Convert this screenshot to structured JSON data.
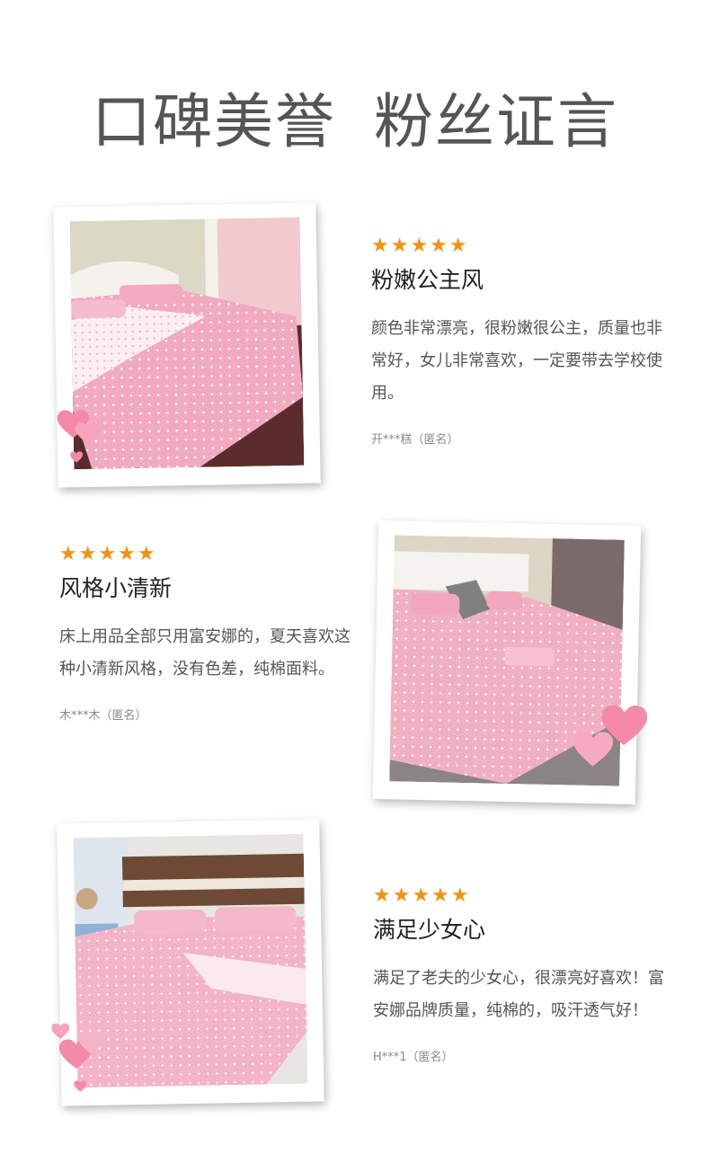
{
  "page": {
    "title_left": "口碑美誉",
    "title_right": "粉丝证言"
  },
  "reviews": [
    {
      "stars": "★★★★★",
      "title": "粉嫩公主风",
      "body": "颜色非常漂亮，很粉嫩很公主，质量也非常好，女儿非常喜欢，一定要带去学校使用。",
      "author": "开***糕（匿名）"
    },
    {
      "stars": "★★★★★",
      "title": "风格小清新",
      "body": "床上用品全部只用富安娜的，夏天喜欢这种小清新风格，没有色差，纯棉面料。",
      "author": "木***木（匿名）"
    },
    {
      "stars": "★★★★★",
      "title": "满足少女心",
      "body": "满足了老夫的少女心，很漂亮好喜欢！富安娜品牌质量，纯棉的，吸汗透气好！",
      "author": "H***1（匿名）"
    }
  ],
  "colors": {
    "star": "#f39212",
    "sheet_pink": "#f2aac1",
    "heart_pink": "#f48aa8",
    "title_gray": "#555555"
  }
}
